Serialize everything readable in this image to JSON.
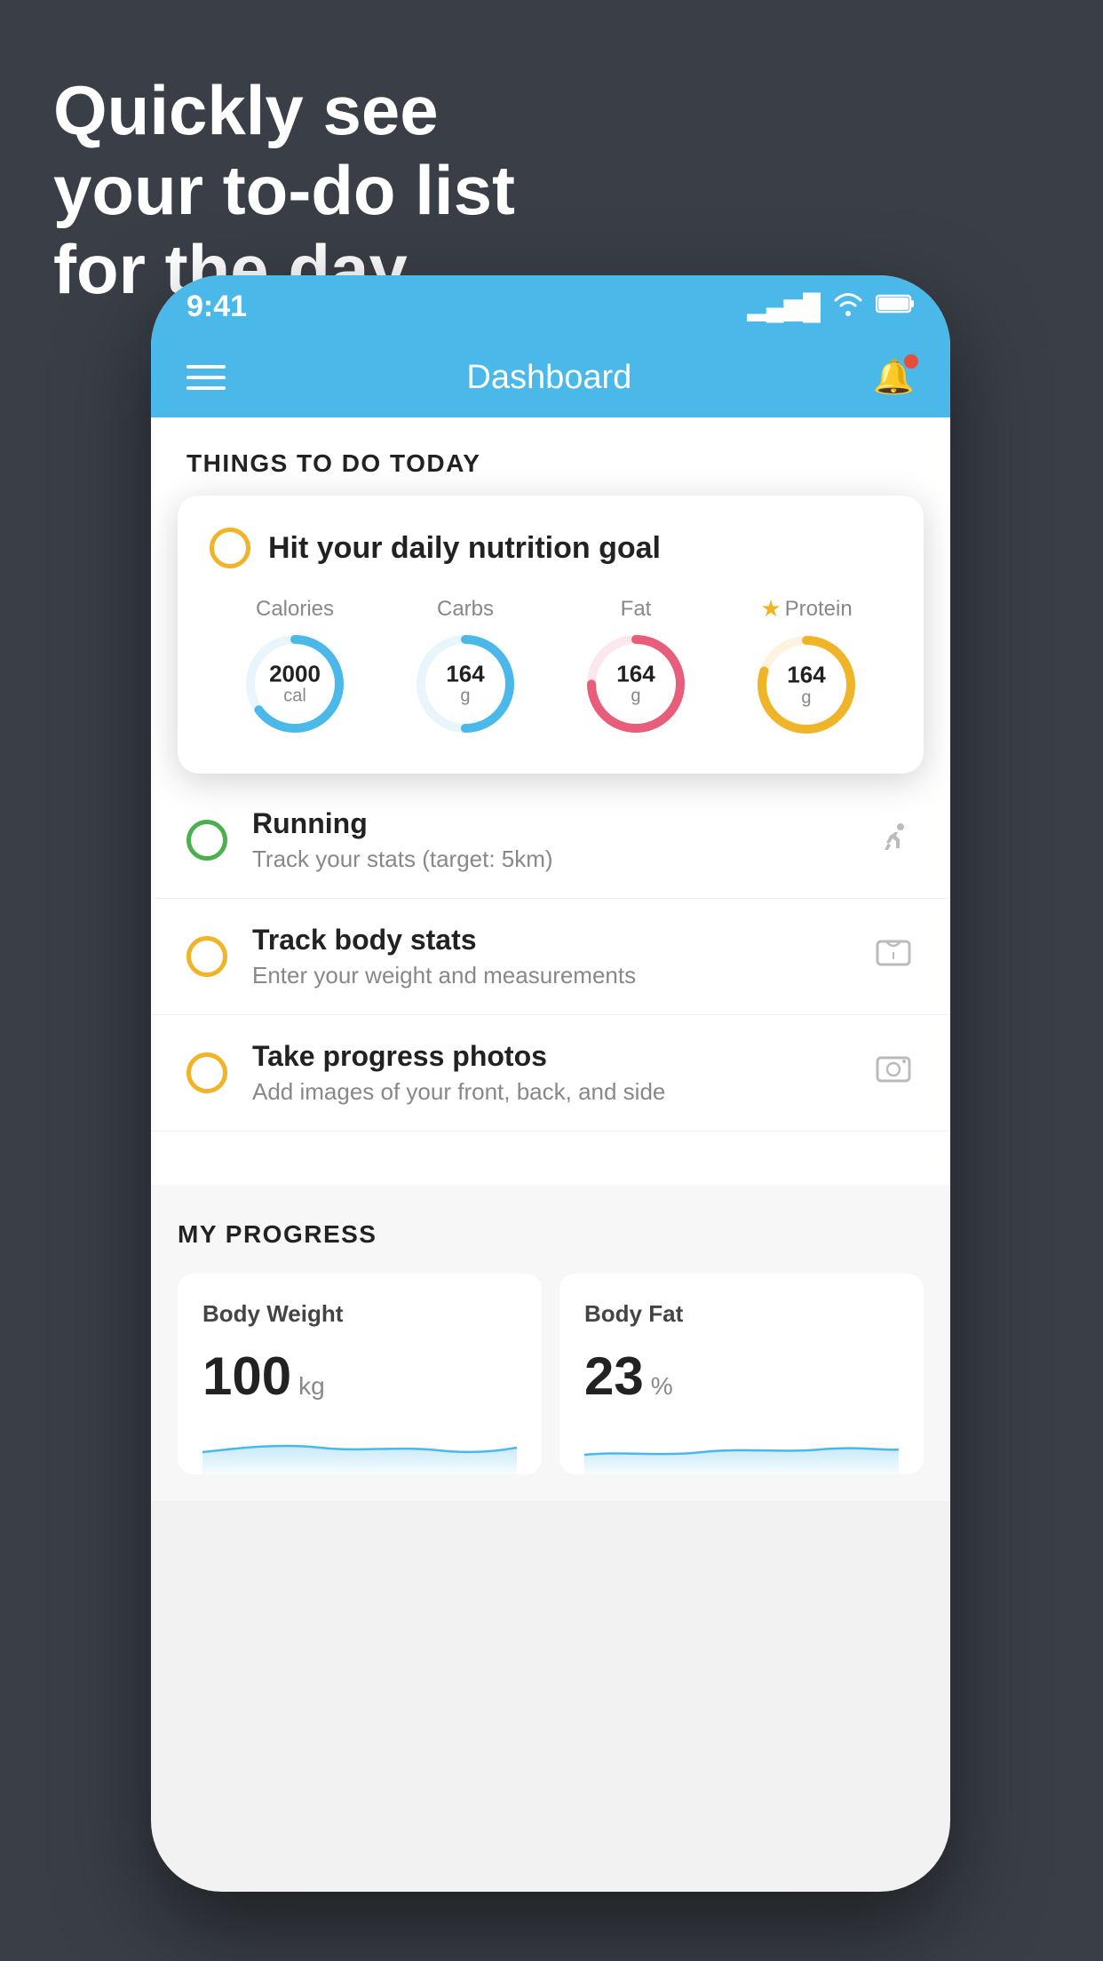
{
  "hero": {
    "line1": "Quickly see",
    "line2": "your to-do list",
    "line3": "for the day."
  },
  "phone": {
    "status": {
      "time": "9:41",
      "signal": "▂▄▆█",
      "wifi": "wifi",
      "battery": "battery"
    },
    "nav": {
      "title": "Dashboard"
    },
    "things_header": "THINGS TO DO TODAY",
    "nutrition_card": {
      "radio": "circle",
      "title": "Hit your daily nutrition goal",
      "items": [
        {
          "label": "Calories",
          "value": "2000",
          "unit": "cal",
          "color": "#4ab8e8",
          "pct": 65
        },
        {
          "label": "Carbs",
          "value": "164",
          "unit": "g",
          "color": "#4ab8e8",
          "pct": 50
        },
        {
          "label": "Fat",
          "value": "164",
          "unit": "g",
          "color": "#e85e7a",
          "pct": 75
        },
        {
          "label": "Protein",
          "value": "164",
          "unit": "g",
          "color": "#f0b429",
          "pct": 80,
          "starred": true
        }
      ]
    },
    "todo_items": [
      {
        "id": "running",
        "type": "green",
        "title": "Running",
        "subtitle": "Track your stats (target: 5km)",
        "icon": "👟"
      },
      {
        "id": "track-body",
        "type": "yellow",
        "title": "Track body stats",
        "subtitle": "Enter your weight and measurements",
        "icon": "⚖️"
      },
      {
        "id": "progress-photo",
        "type": "yellow",
        "title": "Take progress photos",
        "subtitle": "Add images of your front, back, and side",
        "icon": "🖼️"
      }
    ],
    "progress": {
      "header": "MY PROGRESS",
      "cards": [
        {
          "id": "body-weight",
          "label": "Body Weight",
          "value": "100",
          "unit": "kg"
        },
        {
          "id": "body-fat",
          "label": "Body Fat",
          "value": "23",
          "unit": "%"
        }
      ]
    }
  }
}
